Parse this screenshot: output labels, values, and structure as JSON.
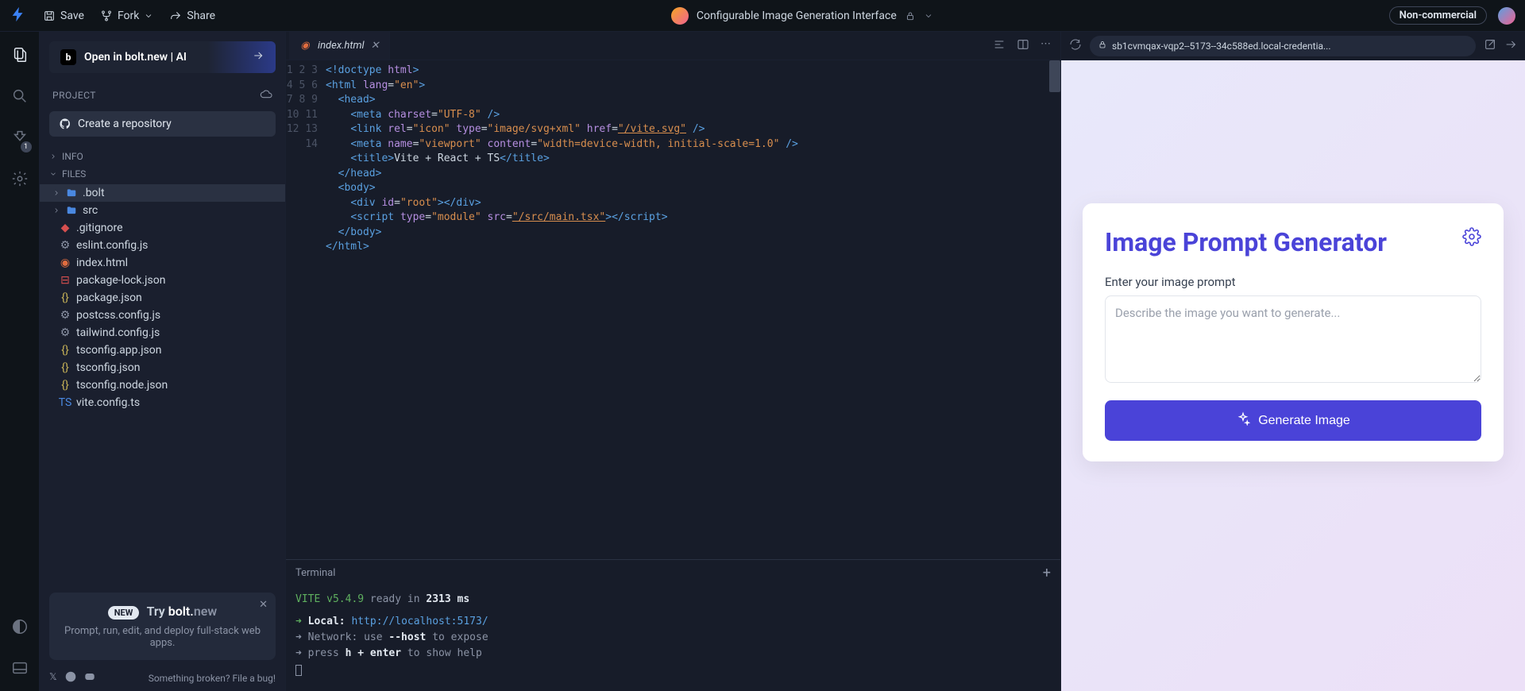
{
  "topbar": {
    "save": "Save",
    "fork": "Fork",
    "share": "Share",
    "title": "Configurable Image Generation Interface",
    "badge": "Non-commercial"
  },
  "activity": {
    "plug_badge": "1"
  },
  "sidebar": {
    "open_in_bolt": "Open in bolt.new | AI",
    "project_label": "PROJECT",
    "create_repo": "Create a repository",
    "info_label": "INFO",
    "files_label": "FILES",
    "tree": {
      "bolt": ".bolt",
      "src": "src",
      "gitignore": ".gitignore",
      "eslint": "eslint.config.js",
      "index": "index.html",
      "pkglock": "package-lock.json",
      "pkg": "package.json",
      "postcss": "postcss.config.js",
      "tailwind": "tailwind.config.js",
      "tsapp": "tsconfig.app.json",
      "tscfg": "tsconfig.json",
      "tsnode": "tsconfig.node.json",
      "vite": "vite.config.ts"
    },
    "promo": {
      "new": "NEW",
      "try": "Try ",
      "bolt": "bolt.",
      "new2": "new",
      "sub": "Prompt, run, edit, and deploy full-stack web apps."
    },
    "bug": "Something broken? File a bug!"
  },
  "editor": {
    "tab_name": "index.html",
    "lines": [
      "1",
      "2",
      "3",
      "4",
      "5",
      "6",
      "7",
      "8",
      "9",
      "10",
      "11",
      "12",
      "13",
      "14"
    ]
  },
  "terminal": {
    "label": "Terminal",
    "vite": "VITE v5.4.9",
    "ready": "  ready in ",
    "ms": "2313 ms",
    "local_arrow": "➜  ",
    "local_label": "Local:   ",
    "local_url": "http://localhost:5173/",
    "net_arrow": "➜  ",
    "net": "Network: use ",
    "host": "--host",
    "net2": " to expose",
    "help_arrow": "➜  ",
    "help1": "press ",
    "help2": "h + enter",
    "help3": " to show help"
  },
  "preview": {
    "url": "sb1cvmqax-vqp2--5173--34c588ed.local-credentia...",
    "card_title": "Image Prompt Generator",
    "input_label": "Enter your image prompt",
    "placeholder": "Describe the image you want to generate...",
    "button": "Generate Image"
  }
}
